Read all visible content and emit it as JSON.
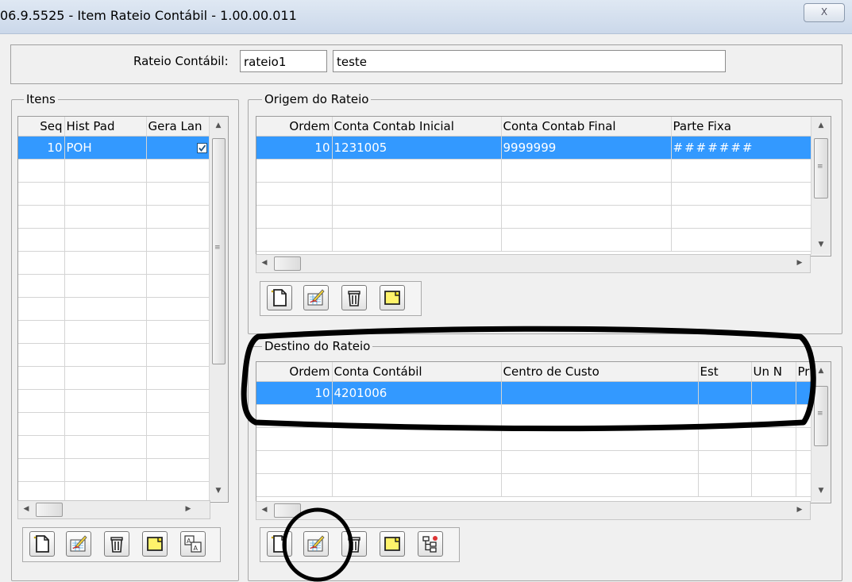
{
  "window": {
    "title": "06.9.5525 - Item Rateio Contábil - 1.00.00.011",
    "close_label": "X"
  },
  "header": {
    "label": "Rateio Contábil:",
    "code": "rateio1",
    "description": "teste"
  },
  "itens": {
    "legend": "Itens",
    "columns": [
      "Seq",
      "Hist Pad",
      "Gera Lan"
    ],
    "rows": [
      {
        "seq": "10",
        "hist_pad": "POH",
        "gera_lan": true
      }
    ]
  },
  "origem": {
    "legend": "Origem do Rateio",
    "columns": [
      "Ordem",
      "Conta Contab Inicial",
      "Conta Contab Final",
      "Parte Fixa"
    ],
    "rows": [
      {
        "ordem": "10",
        "conta_inicial": "1231005",
        "conta_final": "9999999",
        "parte_fixa": "#######"
      }
    ]
  },
  "destino": {
    "legend": "Destino do Rateio",
    "columns": [
      "Ordem",
      "Conta Contábil",
      "Centro de Custo",
      "Est",
      "Un N",
      "Pr"
    ],
    "rows": [
      {
        "ordem": "10",
        "conta": "4201006",
        "centro": "",
        "est": "",
        "un": "",
        "pr": ""
      }
    ]
  },
  "toolbar_icons": {
    "itens": [
      "new-record-icon",
      "edit-record-icon",
      "delete-record-icon",
      "note-icon",
      "translate-icon"
    ],
    "origem": [
      "new-record-icon",
      "edit-record-icon",
      "delete-record-icon",
      "note-icon"
    ],
    "destino": [
      "new-record-icon",
      "edit-record-icon",
      "delete-record-icon",
      "note-icon",
      "hierarchy-icon"
    ]
  },
  "colors": {
    "selection": "#3399ff",
    "annotation": "#000000"
  }
}
